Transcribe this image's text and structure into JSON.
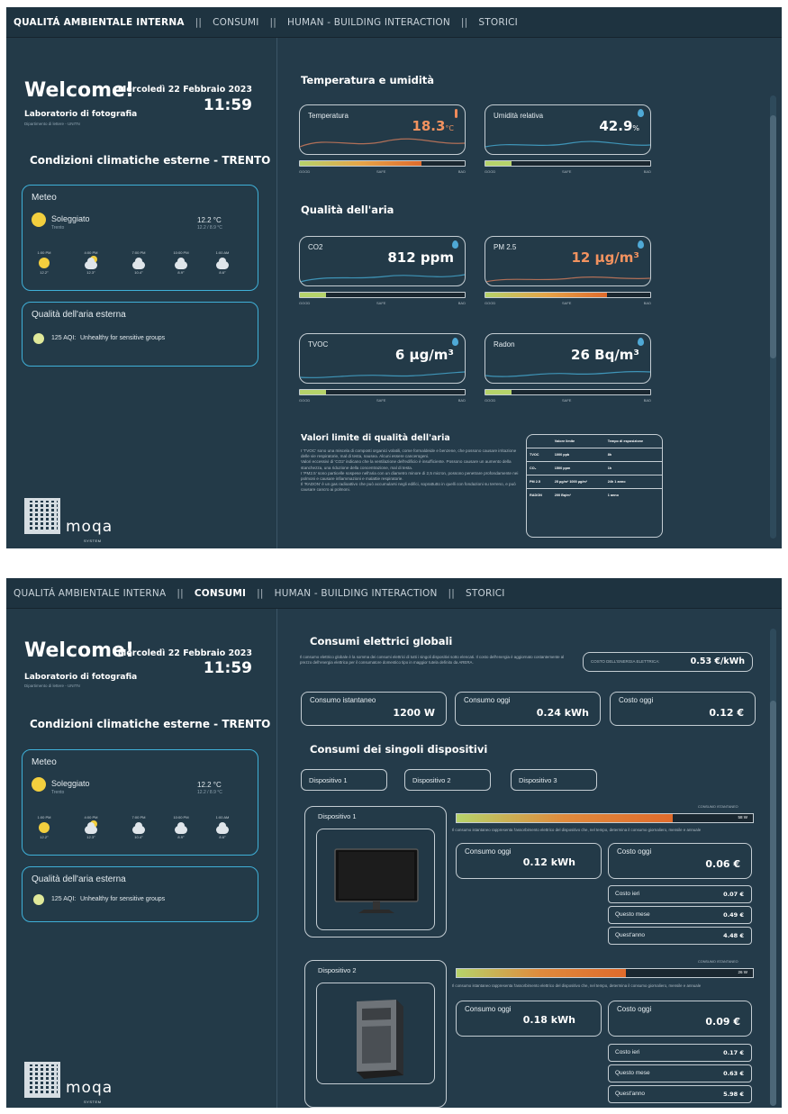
{
  "nav": {
    "items": [
      "QUALITÁ AMBIENTALE INTERNA",
      "CONSUMI",
      "HUMAN - BUILDING INTERACTION",
      "STORICI"
    ],
    "sep": "||"
  },
  "header": {
    "welcome": "Welcome!",
    "date": "Mercoledì 22 Febbraio 2023",
    "time": "11:59",
    "lab": "Laboratorio di fotografia",
    "dept": "Dipartimento di lettere - UNITN"
  },
  "external": {
    "title": "Condizioni climatiche esterne  - TRENTO",
    "meteo": {
      "title": "Meteo",
      "condition": "Soleggiato",
      "city": "Trento",
      "temp": "12.2 °C",
      "range": "12.2 / 8.9 °C",
      "forecast": [
        {
          "hour": "1:00 PM",
          "temp": "12.2°",
          "icon": "sun-icon"
        },
        {
          "hour": "4:00 PM",
          "temp": "12.3°",
          "icon": "partly-cloudy-icon"
        },
        {
          "hour": "7:00 PM",
          "temp": "10.4°",
          "icon": "cloud-icon"
        },
        {
          "hour": "10:00 PM",
          "temp": "8.9°",
          "icon": "cloud-icon"
        },
        {
          "hour": "1:00 AM",
          "temp": "8.6°",
          "icon": "cloud-icon"
        }
      ]
    },
    "air": {
      "title": "Qualità dell'aria esterna",
      "aqi": "125 AQI:",
      "label": "Unhealthy for sensitive groups"
    }
  },
  "logo": {
    "name": "moqa",
    "sub": "SYSTEM"
  },
  "iaq": {
    "section1": "Temperatura e umidità",
    "section2": "Qualità dell'aria",
    "scale": [
      "GOOD",
      "SAFE",
      "BAD"
    ],
    "metrics": [
      {
        "label": "Temperatura",
        "value": "18.3",
        "unit": "°C",
        "level": 0.74,
        "color": "#f2925f"
      },
      {
        "label": "Umidità relativa",
        "value": "42.9",
        "unit": "%",
        "level": 0.16,
        "color": "#ffffff"
      },
      {
        "label": "CO2",
        "value": "812 ppm",
        "unit": "",
        "level": 0.16,
        "color": "#ffffff"
      },
      {
        "label": "PM 2.5",
        "value": "12 µg/m³",
        "unit": "",
        "level": 0.74,
        "color": "#f2925f"
      },
      {
        "label": "TVOC",
        "value": "6 µg/m³",
        "unit": "",
        "level": 0.16,
        "color": "#ffffff"
      },
      {
        "label": "Radon",
        "value": "26 Bq/m³",
        "unit": "",
        "level": 0.16,
        "color": "#ffffff"
      }
    ],
    "limits": {
      "title": "Valori limite di qualità dell'aria",
      "text": "I 'TVOC' sono una miscela di composti organici volatili, come formaldeide e benzene, che possono causare irritazione delle vie respiratorie, mal di testa, nausea. Alcuni essere cancerogeni.\nValori eccessivi di 'CO2' indicano che la ventilazione dell'edificio è insufficiente. Possono causare un aumento della stanchezza, una riduzione della concentrazione, mal di testa.\nI 'PM2.5' sono particelle sospese nell'aria con un diametro minore di 2,5 micron, possono penetrare profondamente nei polmoni e causare infiammazioni e malattie respiratorie.\nIl 'RADON' è un gas radioattivo che può accumularsi negli edifici, soprattutto in quelli con fondazioni su terreno, e può causare cancro ai polmoni.",
      "headers": [
        "",
        "Valore limite",
        "Tempo di esposizione"
      ],
      "rows": [
        [
          "TVOC",
          "1000 ppb",
          "8h"
        ],
        [
          "CO₂",
          "1500 ppm",
          "1h"
        ],
        [
          "PM 2.5",
          "25 µg/m³ 1000 µg/m³",
          "24h 1 anno"
        ],
        [
          "RADON",
          "200 Bq/m³",
          "1 anno"
        ]
      ]
    }
  },
  "consumi": {
    "title": "Consumi elettrici globali",
    "desc": "Il consumo elettrico globale è la somma dei consumi elettrici di tutti i singoli dispositivi sotto elencati. Il costo dell'energia è aggiornato costantemente al prezzo dell'energia elettrica per il consumatore domestico tipo in maggior tutela definito da ARERA.",
    "energy_cost_label": "COSTO DELL'ENERGIA ELETTRICA:",
    "energy_cost": "0.53 €/kWh",
    "cards": [
      {
        "label": "Consumo istantaneo",
        "value": "1200 W"
      },
      {
        "label": "Consumo oggi",
        "value": "0.24 kWh"
      },
      {
        "label": "Costo oggi",
        "value": "0.12 €"
      }
    ],
    "devices_title": "Consumi dei singoli dispositivi",
    "device_buttons": [
      "Dispositivo 1",
      "Dispositivo 2",
      "Dispositivo 3"
    ],
    "inst_label": "CONSUMO ISTANTANEO",
    "inst_desc": "Il consumo istantaneo rappresenta l'assorbimento elettrico del dispositivo che, nel tempo, determina il consumo giornaliero, mensile e annuale",
    "today_label": "Consumo oggi",
    "cost_label": "Costo oggi",
    "devices": [
      {
        "name": "Dispositivo 1",
        "image": "monitor-image",
        "watts": "58 W",
        "level": 0.73,
        "consumo_oggi": "0.12 kWh",
        "costo_oggi": "0.06 €",
        "rows": [
          {
            "label": "Costo ieri",
            "value": "0.07 €"
          },
          {
            "label": "Questo mese",
            "value": "0.49 €"
          },
          {
            "label": "Quest'anno",
            "value": "4.48 €"
          }
        ]
      },
      {
        "name": "Dispositivo 2",
        "image": "pc-tower-image",
        "watts": "26 W",
        "level": 0.57,
        "consumo_oggi": "0.18 kWh",
        "costo_oggi": "0.09 €",
        "rows": [
          {
            "label": "Costo ieri",
            "value": "0.17 €"
          },
          {
            "label": "Questo mese",
            "value": "0.63 €"
          },
          {
            "label": "Quest'anno",
            "value": "5.98 €"
          }
        ]
      }
    ]
  }
}
